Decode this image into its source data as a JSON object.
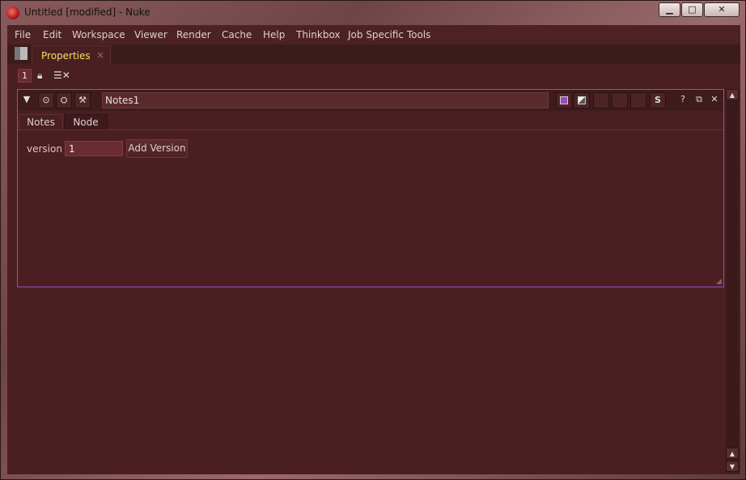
{
  "window": {
    "title": "Untitled [modified] - Nuke",
    "controls": {
      "minimize": "▁",
      "maximize": "□",
      "close": "✕"
    }
  },
  "menu": [
    "File",
    "Edit",
    "Workspace",
    "Viewer",
    "Render",
    "Cache",
    "Help",
    "Thinkbox",
    "Job Specific Tools"
  ],
  "pane_tab": {
    "label": "Properties",
    "close": "×"
  },
  "toolbar": {
    "max_panels": "1",
    "lock_icon": "lock-icon",
    "clear_icon": "clear-panels-icon"
  },
  "node_panel": {
    "name": "Notes1",
    "tabs": [
      "Notes",
      "Node"
    ],
    "knobs": {
      "version_label": "version",
      "version_value": "1",
      "add_button": "Add Version"
    },
    "header_buttons": {
      "help": "?",
      "float": "⧉",
      "close": "✕",
      "s_label": "S"
    },
    "accent_color": "#9a4ac0"
  },
  "colors": {
    "background": "#4a1f21",
    "tab_active_text": "#f0e060"
  }
}
